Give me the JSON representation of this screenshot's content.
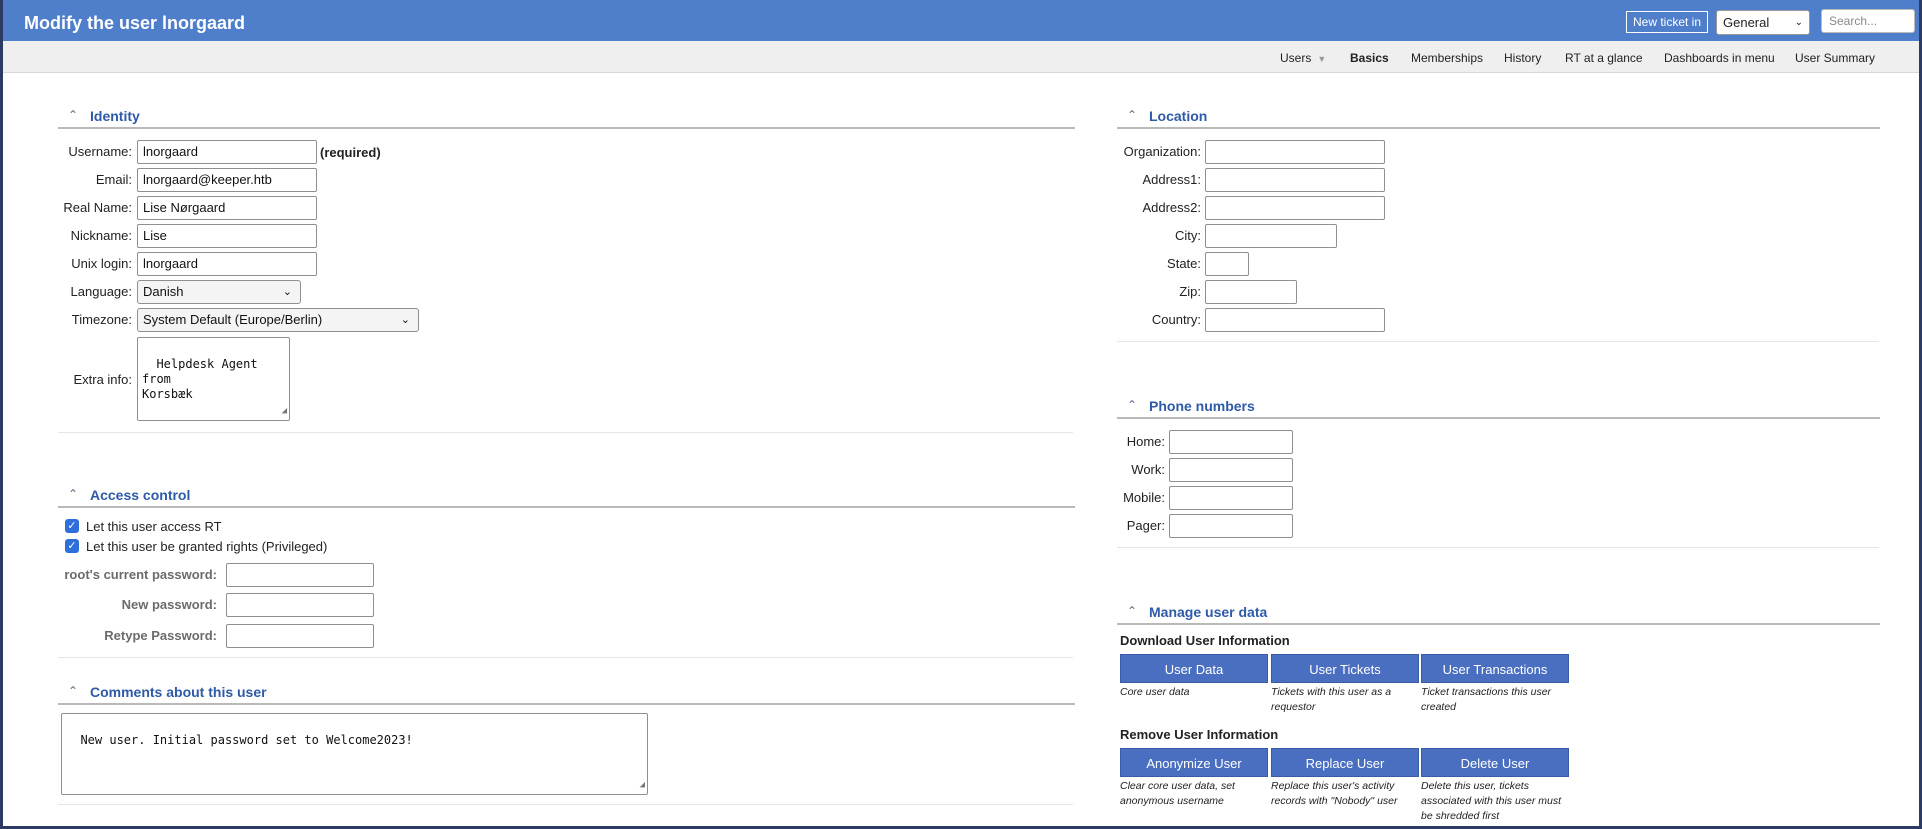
{
  "header": {
    "title": "Modify the user lnorgaard",
    "new_ticket_label": "New ticket in",
    "queue_value": "General",
    "search_placeholder": "Search..."
  },
  "subnav": {
    "items": [
      "Users",
      "Basics",
      "Memberships",
      "History",
      "RT at a glance",
      "Dashboards in menu",
      "User Summary"
    ],
    "active": "Basics"
  },
  "identity": {
    "section_title": "Identity",
    "username_label": "Username:",
    "username_value": "lnorgaard",
    "required": "(required)",
    "email_label": "Email:",
    "email_value": "lnorgaard@keeper.htb",
    "realname_label": "Real Name:",
    "realname_value": "Lise Nørgaard",
    "nickname_label": "Nickname:",
    "nickname_value": "Lise",
    "unix_label": "Unix login:",
    "unix_value": "lnorgaard",
    "language_label": "Language:",
    "language_value": "Danish",
    "timezone_label": "Timezone:",
    "timezone_value": "System Default (Europe/Berlin)",
    "extra_label": "Extra info:",
    "extra_value": "Helpdesk Agent from\nKorsbæk"
  },
  "access": {
    "section_title": "Access control",
    "check1": "Let this user access RT",
    "check2": "Let this user be granted rights (Privileged)",
    "current_pw_label": "root's current password:",
    "new_pw_label": "New password:",
    "retype_pw_label": "Retype Password:"
  },
  "comments": {
    "section_title": "Comments about this user",
    "value": "New user. Initial password set to Welcome2023!"
  },
  "location": {
    "section_title": "Location",
    "org_label": "Organization:",
    "addr1_label": "Address1:",
    "addr2_label": "Address2:",
    "city_label": "City:",
    "state_label": "State:",
    "zip_label": "Zip:",
    "country_label": "Country:"
  },
  "phones": {
    "section_title": "Phone numbers",
    "home_label": "Home:",
    "work_label": "Work:",
    "mobile_label": "Mobile:",
    "pager_label": "Pager:"
  },
  "manage": {
    "section_title": "Manage user data",
    "download_heading": "Download User Information",
    "btn_user_data": "User Data",
    "btn_user_tickets": "User Tickets",
    "btn_user_transactions": "User Transactions",
    "note_user_data": "Core user data",
    "note_user_tickets": "Tickets with this user as a requestor",
    "note_user_transactions": "Ticket transactions this user created",
    "remove_heading": "Remove User Information",
    "btn_anonymize": "Anonymize User",
    "btn_replace": "Replace User",
    "btn_delete": "Delete User",
    "note_anonymize": "Clear core user data, set anonymous username",
    "note_replace": "Replace this user's activity records with \"Nobody\" user",
    "note_delete": "Delete this user, tickets associated with this user must be shredded first"
  }
}
